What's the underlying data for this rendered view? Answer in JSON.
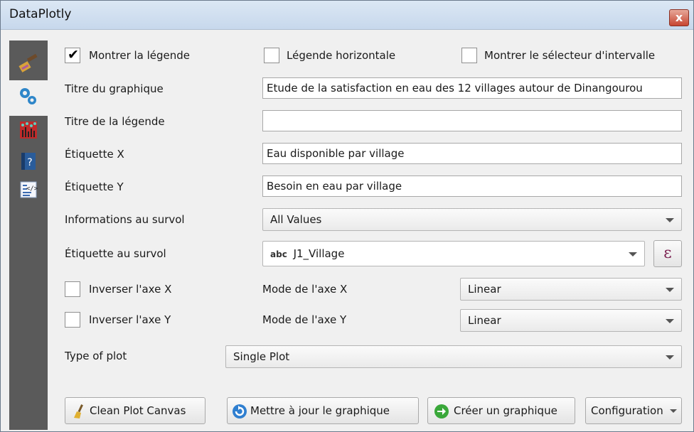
{
  "window": {
    "title": "DataPlotly",
    "close_glyph": "x"
  },
  "sidebar": {
    "items": [
      "properties-brush-icon",
      "settings-gears-icon",
      "plot-scatter-icon",
      "help-book-icon",
      "code-icon"
    ]
  },
  "legend": {
    "show_legend_label": "Montrer la légende",
    "show_legend_checked": true,
    "horizontal_label": "Légende horizontale",
    "horizontal_checked": false,
    "range_selector_label": "Montrer le sélecteur d'intervalle",
    "range_selector_checked": false
  },
  "form": {
    "plot_title_label": "Titre du graphique",
    "plot_title_value": "Etude de la satisfaction en eau des 12 villages autour de Dinangourou",
    "legend_title_label": "Titre de la légende",
    "legend_title_value": "",
    "x_label_label": "Étiquette X",
    "x_label_value": "Eau disponible par village",
    "y_label_label": "Étiquette Y",
    "y_label_value": "Besoin en eau par village",
    "hover_info_label": "Informations au survol",
    "hover_info_value": "All Values",
    "hover_label_label": "Étiquette au survol",
    "hover_label_type": "abc",
    "hover_label_value": "J1_Village",
    "expression_glyph": "ε",
    "invert_x_label": "Inverser l'axe X",
    "invert_x_checked": false,
    "x_mode_label": "Mode de l'axe X",
    "x_mode_value": "Linear",
    "invert_y_label": "Inverser l'axe Y",
    "invert_y_checked": false,
    "y_mode_label": "Mode de l'axe Y",
    "y_mode_value": "Linear",
    "plot_type_label": "Type of plot",
    "plot_type_value": "Single Plot"
  },
  "buttons": {
    "clean_label": "Clean Plot Canvas",
    "update_label": "Mettre à jour le graphique",
    "create_label": "Créer un graphique",
    "config_label": "Configuration"
  },
  "colors": {
    "sidebar": "#5a5a5a",
    "titlebar": "#c7d8ec",
    "close": "#c74531",
    "accent_green": "#3aa83a",
    "accent_blue": "#2f7fd0"
  }
}
